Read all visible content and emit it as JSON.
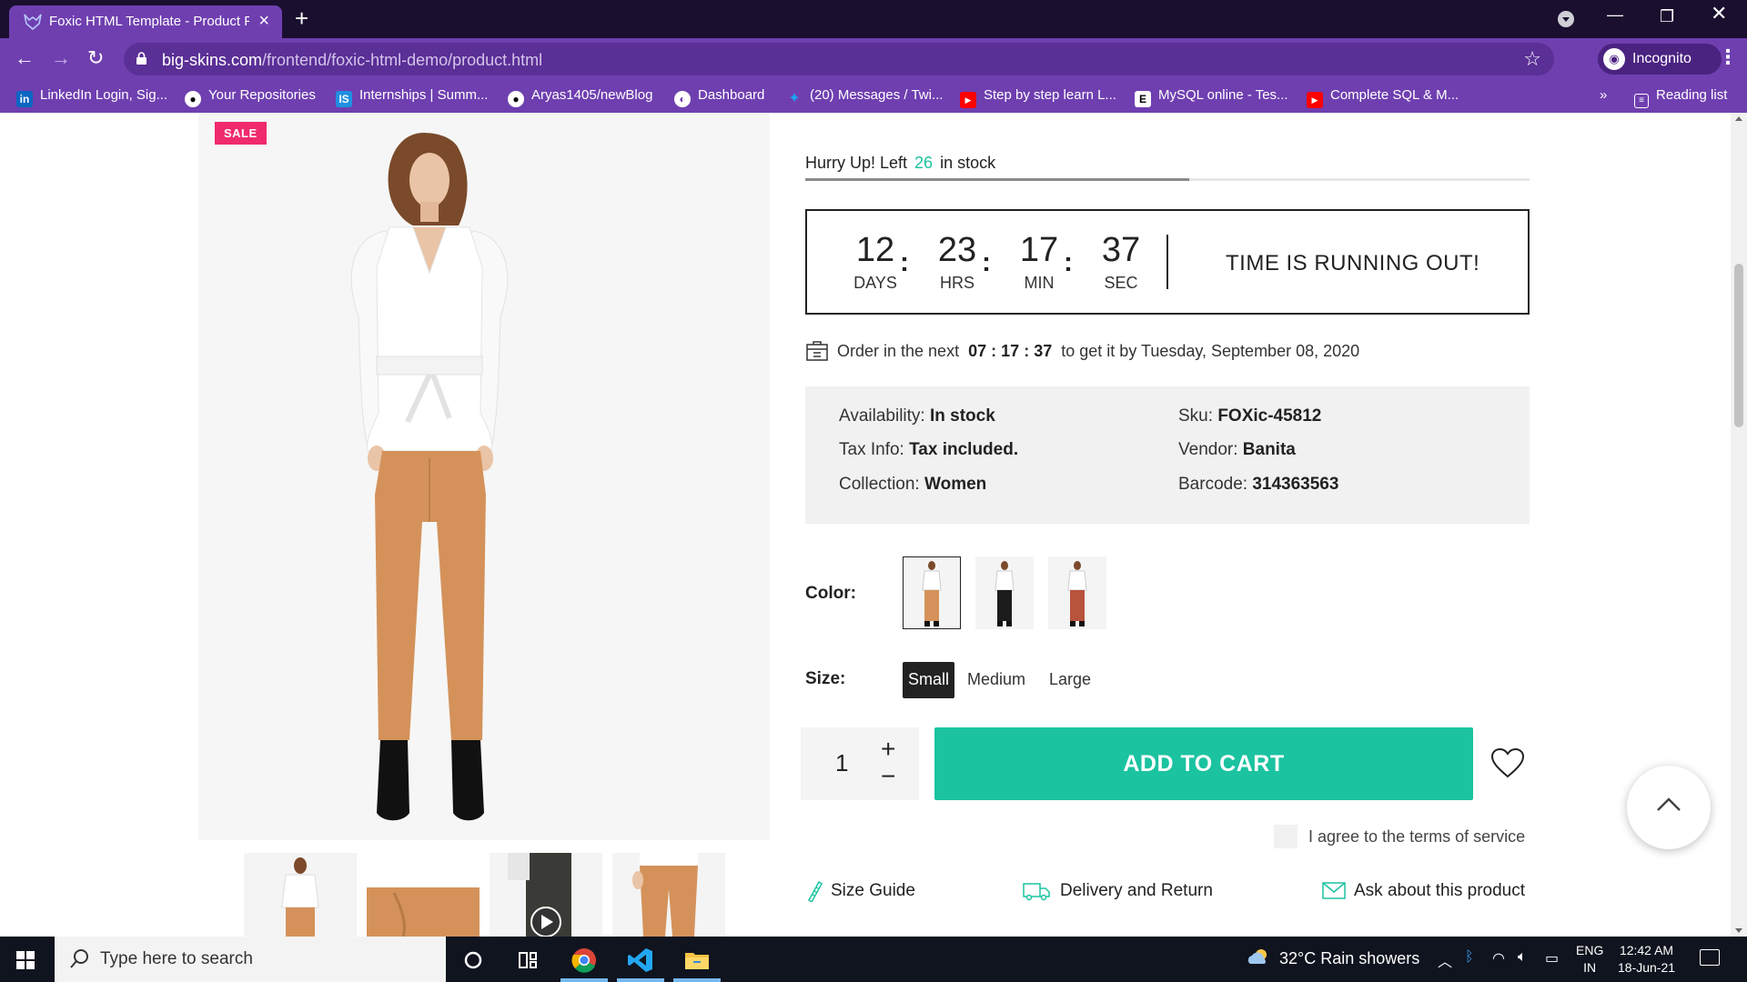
{
  "browser": {
    "tab_title": "Foxic HTML Template - Product P",
    "url_host": "big-skins.com",
    "url_path": "/frontend/foxic-html-demo/product.html",
    "incognito_label": "Incognito",
    "bookmarks": [
      {
        "label": "LinkedIn Login, Sig...",
        "icon": "linkedin-icon"
      },
      {
        "label": "Your Repositories",
        "icon": "github-icon"
      },
      {
        "label": "Internships | Summ...",
        "icon": "internshala-icon"
      },
      {
        "label": "Aryas1405/newBlog",
        "icon": "github-icon"
      },
      {
        "label": "Dashboard",
        "icon": "globe-icon"
      },
      {
        "label": "(20) Messages / Twi...",
        "icon": "twitter-icon"
      },
      {
        "label": "Step by step learn L...",
        "icon": "youtube-icon"
      },
      {
        "label": "MySQL online - Tes...",
        "icon": "e-icon"
      },
      {
        "label": "Complete SQL & M...",
        "icon": "youtube-icon"
      }
    ],
    "more_bookmarks": "»",
    "reading_list": "Reading list"
  },
  "product": {
    "sale_badge": "SALE",
    "stock": {
      "prefix": "Hurry Up! Left",
      "count": "26",
      "suffix": "in stock",
      "bar_fraction": 0.53
    },
    "countdown": {
      "days": "12",
      "days_label": "DAYS",
      "hrs": "23",
      "hrs_label": "HRS",
      "min": "17",
      "min_label": "MIN",
      "sec": "37",
      "sec_label": "SEC",
      "separator": ":",
      "message": "TIME IS RUNNING OUT!"
    },
    "order": {
      "prefix": "Order in the next",
      "h": "07",
      "m": "17",
      "s": "37",
      "suffix": "to get it by Tuesday, September 08, 2020"
    },
    "info": {
      "availability_label": "Availability:",
      "availability": "In stock",
      "tax_label": "Tax Info:",
      "tax": "Tax included.",
      "collection_label": "Collection:",
      "collection": "Women",
      "sku_label": "Sku:",
      "sku": "FOXic-45812",
      "vendor_label": "Vendor:",
      "vendor": "Banita",
      "barcode_label": "Barcode:",
      "barcode": "314363563"
    },
    "color_label": "Color:",
    "colors": [
      {
        "pants": "#d4925a",
        "top": "#ffffff",
        "selected": true
      },
      {
        "pants": "#1c1c1c",
        "top": "#ffffff",
        "selected": false
      },
      {
        "pants": "#b8533c",
        "top": "#ffffff",
        "selected": false
      }
    ],
    "size_label": "Size:",
    "sizes": [
      "Small",
      "Medium",
      "Large"
    ],
    "selected_size": "Small",
    "quantity": "1",
    "qty_plus": "+",
    "qty_minus": "−",
    "add_to_cart": "ADD TO CART",
    "terms": "I agree to the terms of service",
    "links": {
      "size_guide": "Size Guide",
      "delivery": "Delivery and Return",
      "ask": "Ask about this product"
    }
  },
  "taskbar": {
    "search_placeholder": "Type here to search",
    "weather": "32°C  Rain showers",
    "lang_1": "ENG",
    "lang_2": "IN",
    "time": "12:42 AM",
    "date": "18-Jun-21"
  },
  "colors": {
    "accent_teal": "#1bc3a0",
    "sale_pink": "#ef2b6d",
    "browser_purple": "#6f3fb0"
  }
}
